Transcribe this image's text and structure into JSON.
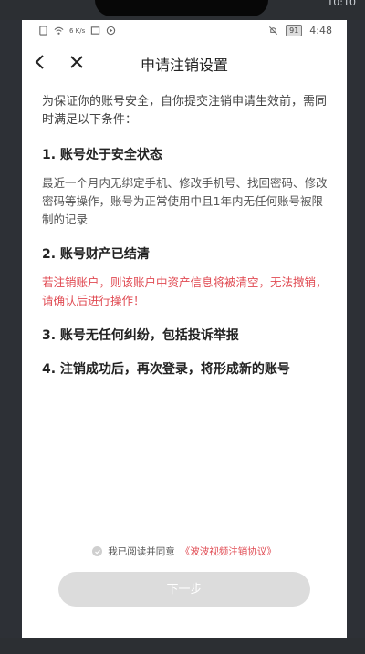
{
  "outer_status": {
    "time": "10:10"
  },
  "status_bar": {
    "net_speed": "6 K/s",
    "battery": "91",
    "time": "4:48"
  },
  "nav": {
    "title": "申请注销设置",
    "back_icon": "chevron-left-icon",
    "close_icon": "close-icon"
  },
  "content": {
    "intro": "为保证你的账号安全，自你提交注销申请生效前，需同时满足以下条件：",
    "sections": [
      {
        "heading": "1. 账号处于安全状态",
        "text": "最近一个月内无绑定手机、修改手机号、找回密码、修改密码等操作，账号为正常使用中且1年内无任何账号被限制的记录"
      },
      {
        "heading": "2. 账号财产已结清",
        "warning": "若注销账户，则该账户中资产信息将被清空，无法撤销，请确认后进行操作！"
      },
      {
        "heading": "3. 账号无任何纠纷，包括投诉举报"
      },
      {
        "heading": "4. 注销成功后，再次登录，将形成新的账号"
      }
    ]
  },
  "agreement": {
    "label": "我已阅读并同意",
    "link": "《波波视频注销协议》"
  },
  "next_button": {
    "label": "下一步"
  },
  "colors": {
    "accent_red": "#e04a52",
    "button_disabled": "#dcdcdc"
  }
}
